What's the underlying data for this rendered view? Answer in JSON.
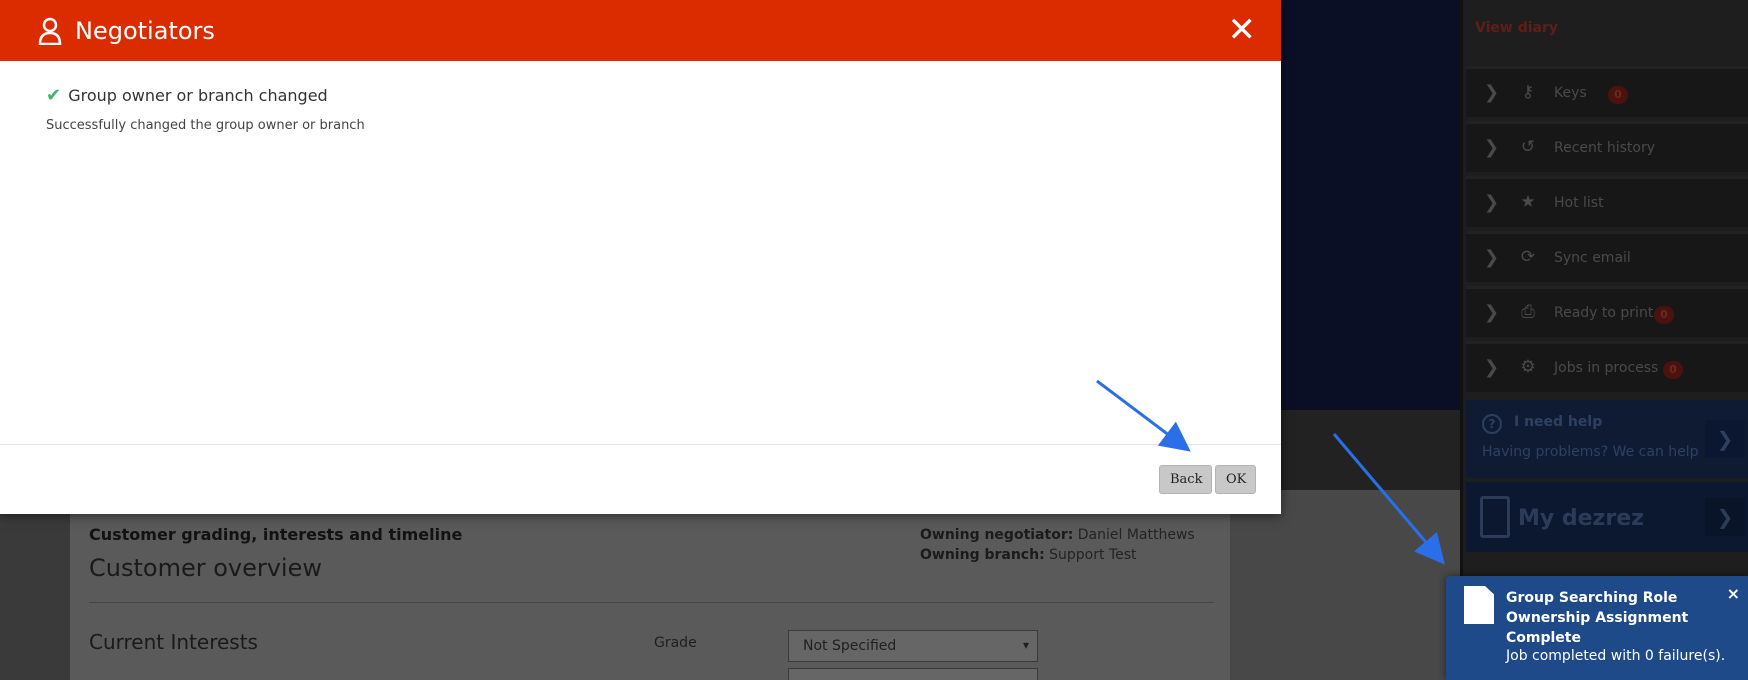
{
  "modal": {
    "title": "Negotiators",
    "close_label": "✕",
    "success_heading": "Group owner or branch changed",
    "success_message": "Successfully changed the group owner or branch",
    "back_label": "Back",
    "ok_label": "OK"
  },
  "content": {
    "section_heading": "Customer grading, interests and timeline",
    "owning_negotiator_label": "Owning negotiator:",
    "owning_negotiator_value": "Daniel Matthews",
    "owning_branch_label": "Owning branch:",
    "owning_branch_value": "Support Test",
    "overview_title": "Customer overview",
    "interests_title": "Current Interests",
    "grade_label": "Grade",
    "grade_value": "Not Specified"
  },
  "sidebar": {
    "view_diary": "View diary",
    "items": [
      {
        "label": "Keys",
        "icon": "key-icon",
        "badge": "0"
      },
      {
        "label": "Recent history",
        "icon": "history-icon",
        "badge": ""
      },
      {
        "label": "Hot list",
        "icon": "star-icon",
        "badge": ""
      },
      {
        "label": "Sync email",
        "icon": "sync-icon",
        "badge": ""
      },
      {
        "label": "Ready to print",
        "icon": "print-icon",
        "badge": "0"
      },
      {
        "label": "Jobs in process",
        "icon": "gear-icon",
        "badge": "0"
      }
    ],
    "help_title": "I need help",
    "help_sub": "Having problems? We can help",
    "dezrez_label": "My dezrez"
  },
  "toast": {
    "title": "Group Searching Role Ownership Assignment Complete",
    "message": "Job completed with 0 failure(s).",
    "close_label": "×"
  },
  "colors": {
    "header_red": "#db2c00",
    "toast_blue": "#1e4a8a",
    "success_green": "#3cb371",
    "annotation_arrow": "#2a6fe8"
  }
}
